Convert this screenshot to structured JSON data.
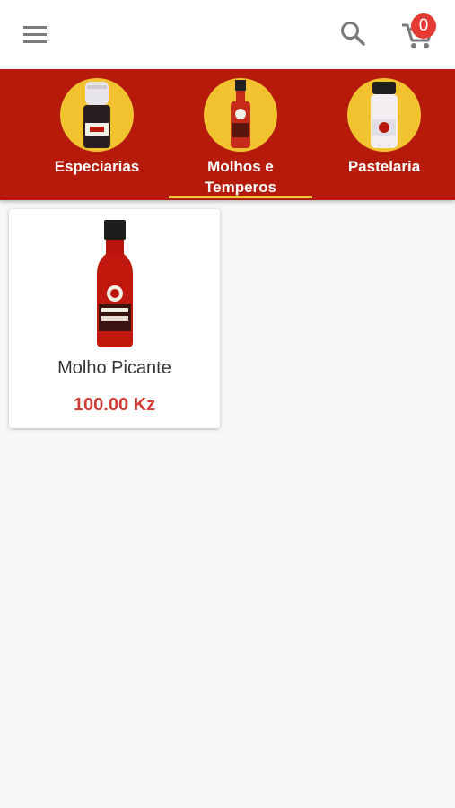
{
  "header": {
    "menu_icon": "hamburger-menu-icon",
    "search_icon": "search-icon",
    "cart_icon": "shopping-cart-icon",
    "cart_count": "0"
  },
  "categories": [
    {
      "label": "Especiarias",
      "image": "spice-bottle",
      "selected": false
    },
    {
      "label": "Molhos e\nTemperos",
      "label_line1": "Molhos e",
      "label_line2": "Temperos",
      "image": "sauce-bottle",
      "selected": true
    },
    {
      "label": "Pastelaria",
      "image": "white-spice-jar",
      "selected": false
    }
  ],
  "products": [
    {
      "name": "Molho Picante",
      "price": "100.00 Kz",
      "image": "molho-picante-bottle"
    }
  ],
  "colors": {
    "category_bar": "#b51a0b",
    "accent_yellow": "#f2c230",
    "price_red": "#d33b34",
    "badge_red": "#e53935",
    "background": "#f7f7f7"
  }
}
